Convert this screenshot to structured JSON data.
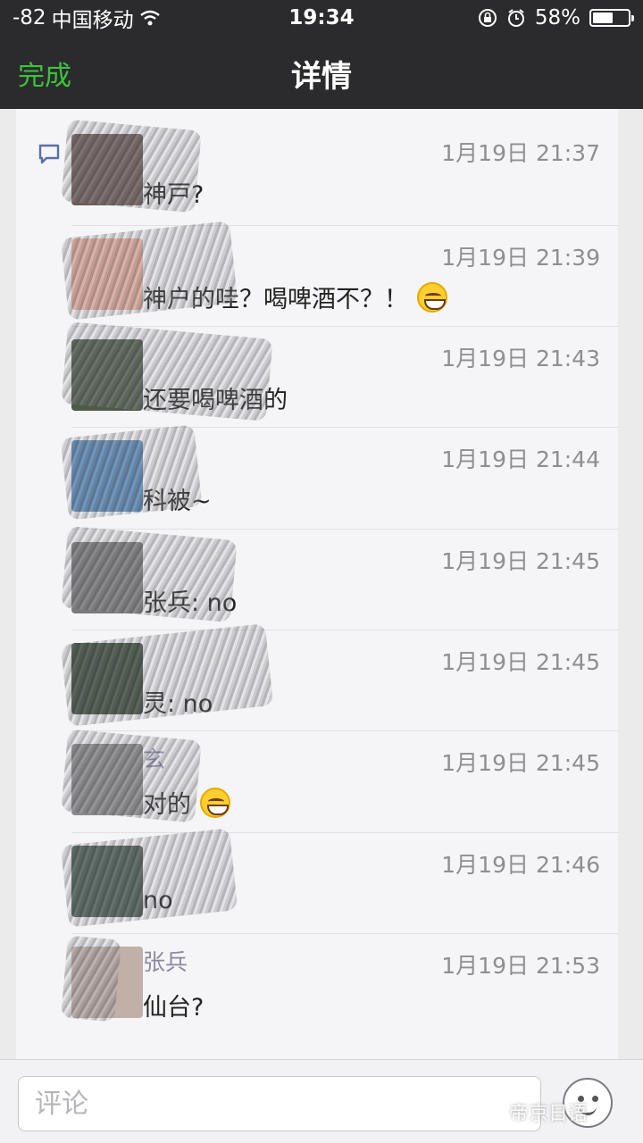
{
  "status_bar": {
    "signal": "-82",
    "carrier": "中国移动",
    "time": "19:34",
    "battery_percent": "58%",
    "battery_level": 0.58
  },
  "nav": {
    "done_label": "完成",
    "title": "详情",
    "accent_color": "#3cc33c"
  },
  "comments": [
    {
      "name": "",
      "time": "1月19日 21:37",
      "text": "神戸?",
      "emoji": false
    },
    {
      "name": "",
      "time": "1月19日 21:39",
      "text": "神户的哇？喝啤酒不？！",
      "emoji": true
    },
    {
      "name": "",
      "time": "1月19日 21:43",
      "text": "还要喝啤酒的",
      "emoji": false
    },
    {
      "name": "",
      "time": "1月19日 21:44",
      "text": "科被~",
      "emoji": false
    },
    {
      "name": "",
      "time": "1月19日 21:45",
      "text": "张兵: no",
      "emoji": false
    },
    {
      "name": "",
      "time": "1月19日 21:45",
      "text": "灵: no",
      "emoji": false
    },
    {
      "name": "玄",
      "time": "1月19日 21:45",
      "text": "对的",
      "emoji": true
    },
    {
      "name": "",
      "time": "1月19日 21:46",
      "text": "no",
      "emoji": false
    },
    {
      "name": "张兵",
      "time": "1月19日 21:53",
      "text": "仙台?",
      "emoji": false
    }
  ],
  "comment_bar": {
    "placeholder": "评论",
    "watermark": "帝京日语"
  },
  "icons": [
    "wifi-icon",
    "orientation-lock-icon",
    "alarm-icon",
    "battery-icon",
    "comment-icon",
    "emoji-face-icon"
  ]
}
